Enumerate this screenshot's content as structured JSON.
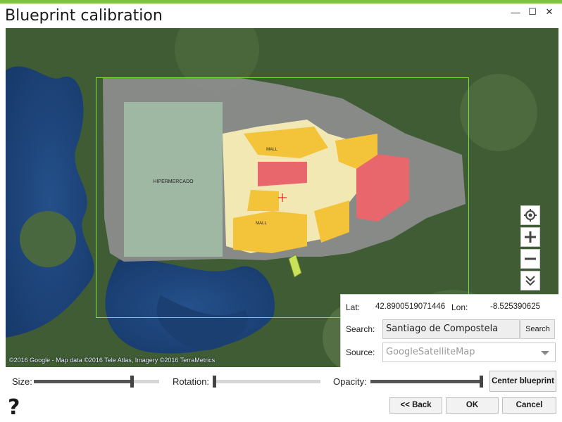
{
  "window": {
    "title": "Blueprint calibration",
    "accent_color": "#7dc242",
    "controls": {
      "minimize": "—",
      "maximize": "☐",
      "close": "✕"
    }
  },
  "map": {
    "attribution": "©2016 Google - Map data ©2016 Tele Atlas, Imagery ©2016 TerraMetrics",
    "blueprint_labels": {
      "hypermarket": "HIPERMERCADO",
      "mall_top": "MALL",
      "mall_bottom": "MALL"
    },
    "calibration_frame_color": "#7ce03c",
    "tools": [
      "locate-icon",
      "zoom-in-icon",
      "zoom-out-icon",
      "expand-down-icon"
    ]
  },
  "location_panel": {
    "lat_label": "Lat:",
    "lat_value": "42.8900519071446",
    "lon_label": "Lon:",
    "lon_value": "-8.525390625",
    "search_label": "Search:",
    "search_value": "Santiago de Compostela",
    "search_button": "Search",
    "source_label": "Source:",
    "source_value": "GoogleSatelliteMap"
  },
  "controls": {
    "size_label": "Size:",
    "size_level": 0.79,
    "rotation_label": "Rotation:",
    "rotation_level": 0.0,
    "opacity_label": "Opacity:",
    "opacity_level": 1.0,
    "center_button": "Center blueprint"
  },
  "footer": {
    "help": "?",
    "back_button": "<< Back",
    "ok_button": "OK",
    "cancel_button": "Cancel"
  }
}
